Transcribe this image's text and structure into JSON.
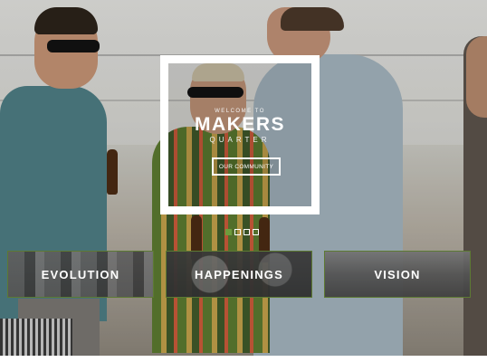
{
  "hero": {
    "welcome": "WELCOME TO",
    "brand": "MAKERS",
    "sub": "QUARTER",
    "cta_label": "OUR COMMUNITY"
  },
  "slider": {
    "dots": 4,
    "active_index": 0,
    "active_color": "#6e9c3c"
  },
  "tiles": [
    {
      "label": "EVOLUTION"
    },
    {
      "label": "HAPPENINGS"
    },
    {
      "label": "VISION"
    }
  ],
  "colors": {
    "frame": "#ffffff",
    "tile_border": "#5d7a33"
  }
}
